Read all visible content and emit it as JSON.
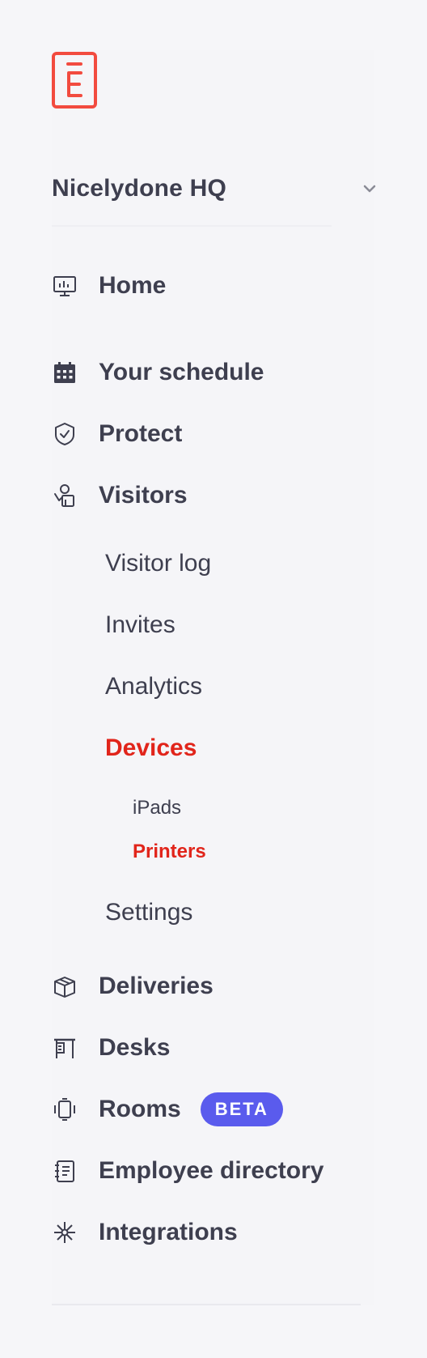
{
  "brand": {
    "logo_icon": "envoy-logo-icon",
    "accent": "#f24b3f"
  },
  "location": {
    "name": "Nicelydone HQ",
    "icon": "chevron-down-icon"
  },
  "nav": {
    "home": {
      "label": "Home",
      "icon": "monitor-chart-icon"
    },
    "schedule": {
      "label": "Your schedule",
      "icon": "calendar-icon"
    },
    "protect": {
      "label": "Protect",
      "icon": "shield-check-icon"
    },
    "visitors": {
      "label": "Visitors",
      "icon": "visitor-icon",
      "children": {
        "visitor_log": "Visitor log",
        "invites": "Invites",
        "analytics": "Analytics",
        "devices": {
          "label": "Devices",
          "children": {
            "ipads": "iPads",
            "printers": "Printers"
          }
        },
        "settings": "Settings"
      }
    },
    "deliveries": {
      "label": "Deliveries",
      "icon": "package-icon"
    },
    "desks": {
      "label": "Desks",
      "icon": "desk-icon"
    },
    "rooms": {
      "label": "Rooms",
      "icon": "room-device-icon",
      "badge": "BETA"
    },
    "employee_directory": {
      "label": "Employee directory",
      "icon": "directory-icon"
    },
    "integrations": {
      "label": "Integrations",
      "icon": "integrations-icon"
    }
  },
  "colors": {
    "active": "#e1251b",
    "text": "#3e3f4f",
    "badge_bg": "#5a5bed"
  }
}
